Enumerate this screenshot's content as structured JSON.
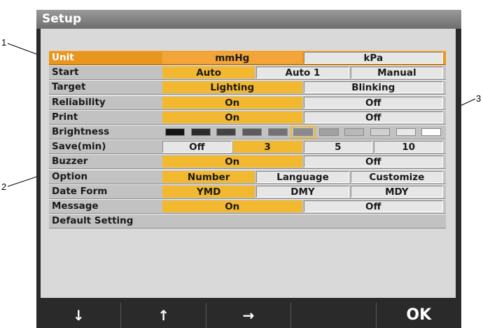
{
  "window": {
    "title": "Setup"
  },
  "callouts": [
    "1",
    "2",
    "3"
  ],
  "rows": [
    {
      "label": "Unit",
      "options": [
        "mmHg",
        "kPa"
      ],
      "selected": 0,
      "highlighted": true
    },
    {
      "label": "Start",
      "options": [
        "Auto",
        "Auto 1",
        "Manual"
      ],
      "selected": 0
    },
    {
      "label": "Target",
      "options": [
        "Lighting",
        "Blinking"
      ],
      "selected": 0
    },
    {
      "label": "Reliability",
      "options": [
        "On",
        "Off"
      ],
      "selected": 0
    },
    {
      "label": "Print",
      "options": [
        "On",
        "Off"
      ],
      "selected": 0
    },
    {
      "label": "Brightness",
      "levels": 11,
      "selected_level": 6
    },
    {
      "label": "Save(min)",
      "options": [
        "Off",
        "3",
        "5",
        "10"
      ],
      "selected": 1
    },
    {
      "label": "Buzzer",
      "options": [
        "On",
        "Off"
      ],
      "selected": 0
    },
    {
      "label": "Option",
      "options": [
        "Number",
        "Language",
        "Customize"
      ],
      "selected": 0
    },
    {
      "label": "Date Form",
      "options": [
        "YMD",
        "DMY",
        "MDY"
      ],
      "selected": 0
    },
    {
      "label": "Message",
      "options": [
        "On",
        "Off"
      ],
      "selected": 0
    },
    {
      "label": "Default Setting"
    }
  ],
  "softkeys": [
    {
      "label": "↓",
      "icon": "arrow-down-icon"
    },
    {
      "label": "↑",
      "icon": "arrow-up-icon"
    },
    {
      "label": "→",
      "icon": "arrow-right-icon"
    },
    {
      "label": "",
      "icon": ""
    },
    {
      "label": "OK",
      "icon": ""
    }
  ],
  "colors": {
    "selected_row": "#e8961e",
    "selected_option": "#f2b830",
    "panel": "#d9d9d9",
    "titlebar": "#8a8a8a"
  }
}
